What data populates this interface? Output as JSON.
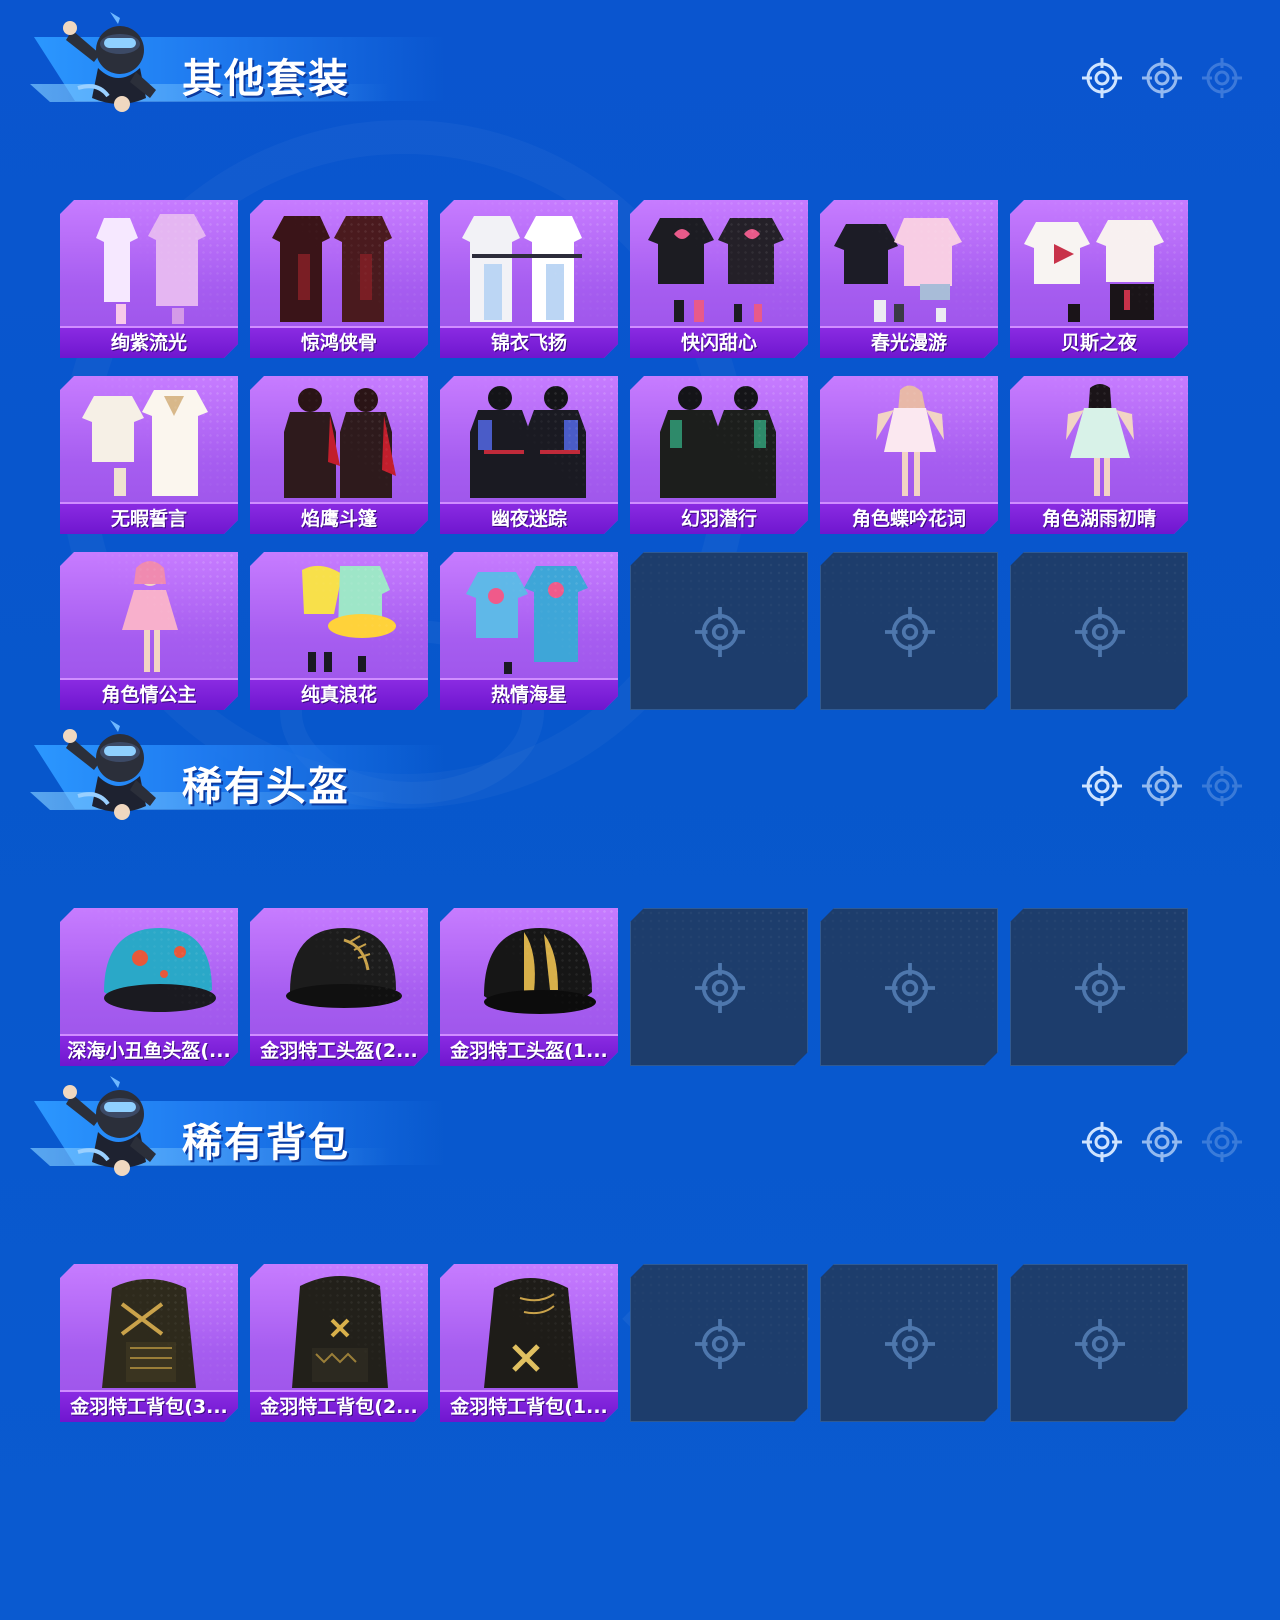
{
  "sections": [
    {
      "title": "其他套装",
      "items": [
        "绚紫流光",
        "惊鸿侠骨",
        "锦衣飞扬",
        "快闪甜心",
        "春光漫游",
        "贝斯之夜",
        "无暇誓言",
        "焰鹰斗篷",
        "幽夜迷踪",
        "幻羽潜行",
        "角色蝶吟花词",
        "角色湖雨初晴",
        "角色情公主",
        "纯真浪花",
        "热情海星"
      ],
      "empty_slots": 3
    },
    {
      "title": "稀有头盔",
      "items": [
        "深海小丑鱼头盔(...",
        "金羽特工头盔(2...",
        "金羽特工头盔(1..."
      ],
      "empty_slots": 3
    },
    {
      "title": "稀有背包",
      "items": [
        "金羽特工背包(3...",
        "金羽特工背包(2...",
        "金羽特工背包(1..."
      ],
      "empty_slots": 3
    }
  ],
  "colors": {
    "background": "#0757cc",
    "card_purple": "#a65df0",
    "label_purple": "#7a1fd8",
    "empty_card": "#1d3d6c"
  },
  "icons": {
    "header_indicator": "crosshair-icon",
    "empty_slot": "crosshair-icon",
    "mascot": "character-mascot"
  }
}
